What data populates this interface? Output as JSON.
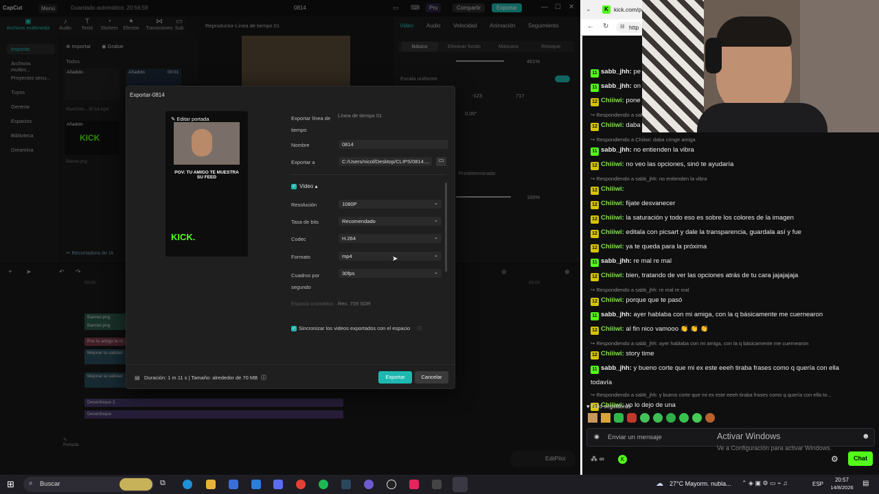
{
  "capcut": {
    "app_name": "CapCut",
    "menu_label": "Menú",
    "autosave": "Guardado automático: 20:56:59",
    "project_title": "0814",
    "pro_label": "Pro",
    "share_label": "Compartir",
    "export_label": "Exportar",
    "media_tabs": [
      "Archivos multimedia",
      "Audio",
      "Texto",
      "Stickers",
      "Efectos",
      "Transiciones",
      "Sub"
    ],
    "sidebar": [
      "Importar",
      "Archivos multim...",
      "Proyectos secu...",
      "Tuyos",
      "Generar",
      "Espacios",
      "Biblioteca",
      "Dreamina"
    ],
    "import_label": "Importar",
    "record_label": "Grabar",
    "all_label": "Todos",
    "added_label": "Añadido",
    "thumb1_name": "05a0026b-...f6714.mp4",
    "thumb2_name": "Banner.png",
    "thumb3_duration": "00:01",
    "ai_cutter_label": "Recortadora de IA",
    "player_title": "Reproductor-Línea de tiempo 01",
    "prop_tabs": [
      "Video",
      "Audio",
      "Velocidad",
      "Animación",
      "Seguimiento"
    ],
    "prop_subtabs": [
      "Básico",
      "Eliminar fondo",
      "Máscara",
      "Retoque"
    ],
    "zoom_value": "461%",
    "uniform_scale": "Escala uniforme",
    "pos_x": "-123",
    "pos_y": "717",
    "rotation": "0.00°",
    "default_label": "Predeterminado",
    "opacity": "100%",
    "track_labels": [
      "Banner.png",
      "Banner.png",
      "Pov tu amigo te m...",
      "Mejorar la calidad",
      "Mejorar la calidad",
      "Desenfoque 2",
      "Desenfoque"
    ],
    "cover_label": "Portada",
    "editpilot": "EditPilot",
    "time_mark1": "00:00",
    "time_mark2": "00:00"
  },
  "dialog": {
    "title": "Exportar-0814",
    "edit_cover": "Editar portada",
    "cover_caption": "POV: TU AMIGO TE MUESTRA SU FEED",
    "cover_logo": "KICK.",
    "export_timeline_label": "Exportar línea de tiempo",
    "export_timeline_value": "Línea de tiempo 01",
    "name_label": "Nombre",
    "name_value": "0814",
    "export_to_label": "Exportar a",
    "export_to_value": "C:/Users/nicol/Desktop/CLIPS/0814....",
    "video_section": "Video",
    "resolution_label": "Resolución",
    "resolution_value": "1080P",
    "bitrate_label": "Tasa de bits",
    "bitrate_value": "Recomendado",
    "codec_label": "Codec",
    "codec_value": "H.264",
    "format_label": "Formato",
    "format_value": "mp4",
    "fps_label": "Cuadros por segundo",
    "fps_value": "30fps",
    "colorspace_label": "Espacio cromático",
    "colorspace_value": "Rec. 709 SDR",
    "sync_label": "Sincronizar los videos exportados con el espacio",
    "duration_info": "Duración: 1 m 11 s | Tamaño: alrededor de 70 MB",
    "export_button": "Exportar",
    "cancel_button": "Cancelar"
  },
  "browser": {
    "tab_title": "kick.com/po",
    "address": "http"
  },
  "chat": {
    "messages": [
      {
        "type": "msg",
        "badge": "11",
        "user": "sabb_jhh",
        "text": " pe"
      },
      {
        "type": "msg",
        "badge": "11",
        "user": "sabb_jhh",
        "text": " on"
      },
      {
        "type": "msg",
        "badge": "12",
        "user": "Chiiiwi",
        "text": " pone"
      },
      {
        "type": "reply",
        "text": "Respondiendo a sabb_jhh: o..."
      },
      {
        "type": "msg",
        "badge": "12",
        "user": "Chiiiwi",
        "text": " daba"
      },
      {
        "type": "reply",
        "text": "Respondiendo a Chiiiwi: daba cringe amiga"
      },
      {
        "type": "msg",
        "badge": "11",
        "user": "sabb_jhh",
        "text": " no entienden la vibra"
      },
      {
        "type": "msg",
        "badge": "12",
        "user": "Chiiiwi",
        "text": " no veo las opciones, sinó te ayudaría"
      },
      {
        "type": "reply",
        "text": "Respondiendo a sabb_jhh: no entienden la vibra"
      },
      {
        "type": "msg",
        "badge": "12",
        "user": "Chiiiwi",
        "text": " "
      },
      {
        "type": "msg",
        "badge": "12",
        "user": "Chiiiwi",
        "text": " fijate desvanecer"
      },
      {
        "type": "msg",
        "badge": "12",
        "user": "Chiiiwi",
        "text": " la saturación y todo eso es sobre los colores de la imagen"
      },
      {
        "type": "msg",
        "badge": "12",
        "user": "Chiiiwi",
        "text": " editala con picsart y dale la transparencia, guardala así y fue"
      },
      {
        "type": "msg",
        "badge": "12",
        "user": "Chiiiwi",
        "text": " ya te queda para la próxima"
      },
      {
        "type": "msg",
        "badge": "11",
        "user": "sabb_jhh",
        "text": " re mal re mal"
      },
      {
        "type": "msg",
        "badge": "12",
        "user": "Chiiiwi",
        "text": " bien, tratando de ver las opciones atrás de tu cara jajajajaja"
      },
      {
        "type": "reply",
        "text": "Respondiendo a sabb_jhh: re mal re mal"
      },
      {
        "type": "msg",
        "badge": "12",
        "user": "Chiiiwi",
        "text": " porque que te pasó"
      },
      {
        "type": "msg",
        "badge": "11",
        "user": "sabb_jhh",
        "text": " ayer hablaba con mi amiga, con la q básicamente me cuernearon"
      },
      {
        "type": "msg",
        "badge": "12",
        "user": "Chiiiwi",
        "text": " al fin nico vamooo 👏 👏 👏"
      },
      {
        "type": "reply",
        "text": "Respondiendo a sabb_jhh: ayer hablaba con mi amiga, con la q básicamente me cuernearon"
      },
      {
        "type": "msg",
        "badge": "12",
        "user": "Chiiiwi",
        "text": " story time"
      },
      {
        "type": "msg",
        "badge": "11",
        "user": "sabb_jhh",
        "text": " y bueno corte que mi ex este eeeh tiraba frases como q quería con ella"
      },
      {
        "type": "cont",
        "text": "todavía"
      },
      {
        "type": "reply",
        "text": "Respondiendo a sabb_jhh: y bueno corte que mi ex este eeeh tiraba frases como q quería con ella to..."
      },
      {
        "type": "msg",
        "badge": "12",
        "user": "Chiiiwi",
        "text": " yo lo dejo de una"
      }
    ],
    "followers_only": "Solo seguidores",
    "input_placeholder": "Enviar un mensaje",
    "chat_button": "Chat",
    "activate_title": "Activar Windows",
    "activate_sub": "Ve a Configuración para activar Windows."
  },
  "taskbar": {
    "search": "Buscar",
    "weather": "27°C  Mayorm. nubla...",
    "lang": "ESP",
    "time": "20:57",
    "date": "14/8/2026"
  },
  "colors": {
    "accent": "#1fb8b0",
    "kick_green": "#53fc18",
    "badge_yellow": "#d6c300"
  }
}
